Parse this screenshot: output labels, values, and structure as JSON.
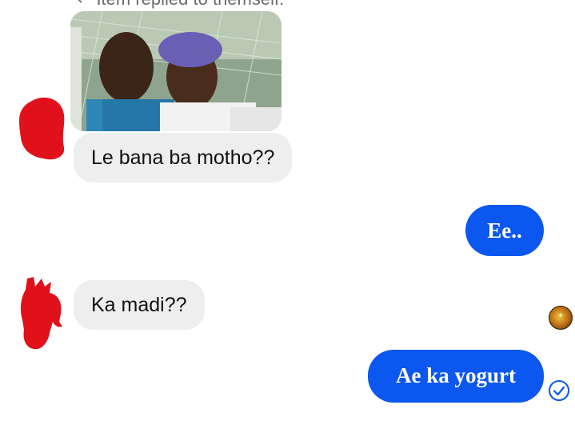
{
  "conversation": {
    "reply_context": "Item replied to themself.",
    "messages": [
      {
        "side": "incoming",
        "text": "Le bana ba motho??"
      },
      {
        "side": "outgoing",
        "text": "Ee.."
      },
      {
        "side": "incoming",
        "text": "Ka madi??"
      },
      {
        "side": "outgoing",
        "text": "Ae ka yogurt"
      }
    ]
  },
  "colors": {
    "outgoing_bubble": "#0b57ef",
    "incoming_bubble": "#eeeeef",
    "redaction": "#e0111b"
  },
  "icons": {
    "reply": "reply-arrow-icon",
    "seen_avatar": "seen-avatar-icon",
    "delivered": "check-circle-icon"
  }
}
